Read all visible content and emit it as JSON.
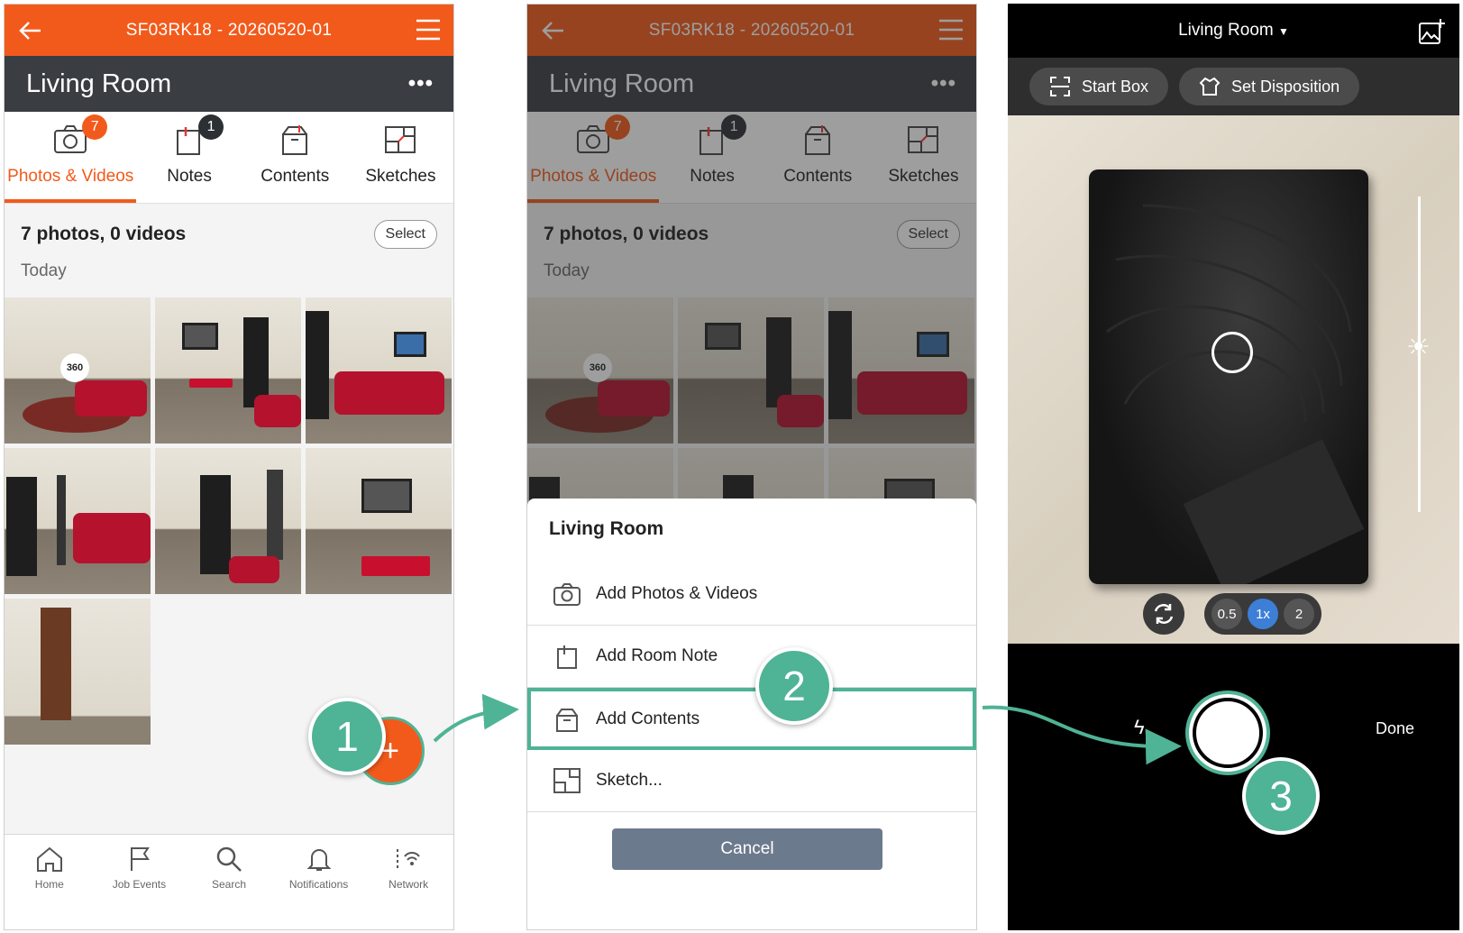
{
  "phone1": {
    "appbar_title": "SF03RK18 - 20260520-01",
    "room": "Living Room",
    "tabs": [
      {
        "label": "Photos & Videos",
        "badge": "7"
      },
      {
        "label": "Notes",
        "badge": "1"
      },
      {
        "label": "Contents"
      },
      {
        "label": "Sketches"
      }
    ],
    "summary": "7 photos, 0 videos",
    "select_label": "Select",
    "date_group": "Today",
    "photo_badge": "360",
    "fab": "+",
    "nav": [
      {
        "label": "Home"
      },
      {
        "label": "Job Events"
      },
      {
        "label": "Search"
      },
      {
        "label": "Notifications"
      },
      {
        "label": "Network"
      }
    ]
  },
  "phone2": {
    "appbar_title": "SF03RK18 - 20260520-01",
    "room": "Living Room",
    "sheet_title": "Living Room",
    "sheet_items": [
      {
        "label": "Add Photos & Videos",
        "icon": "camera-icon"
      },
      {
        "label": "Add Room Note",
        "icon": "note-icon"
      },
      {
        "label": "Add Contents",
        "icon": "box-icon"
      },
      {
        "label": "Sketch...",
        "icon": "sketch-icon"
      }
    ],
    "cancel_label": "Cancel"
  },
  "phone3": {
    "room_dropdown": "Living Room",
    "start_box_label": "Start Box",
    "set_disposition_label": "Set Disposition",
    "zoom_options": [
      "0.5",
      "1x",
      "2"
    ],
    "zoom_selected": "1x",
    "done_label": "Done"
  },
  "steps": [
    "1",
    "2",
    "3"
  ],
  "colors": {
    "brand_orange": "#f25a1b",
    "dark_bar": "#3a3d42",
    "callout_green": "#4fb395",
    "cancel_gray": "#6c7a8e"
  }
}
